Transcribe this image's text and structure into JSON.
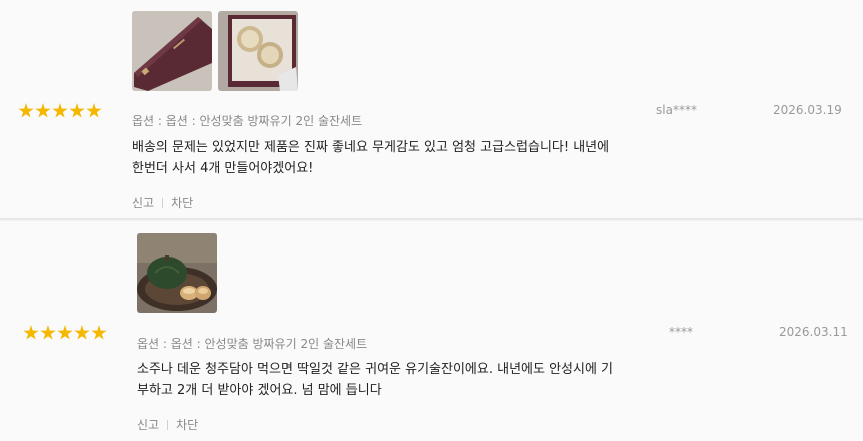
{
  "reviews": [
    {
      "rating": 5,
      "option": "옵션 : 옵션 : 안성맞춤 방짜유기 2인 술잔세트",
      "text": "배송의 문제는 있었지만 제품은 진짜 좋네요 무게감도 있고 엄청 고급스럽습니다! 내년에 한번더 사서 4개 만들어야겠어요!",
      "author": "sla****",
      "date": "2026.03.19",
      "report_label": "신고",
      "block_label": "차단"
    },
    {
      "rating": 5,
      "option": "옵션 : 옵션 : 안성맞춤 방짜유기 2인 술잔세트",
      "text": "소주나 데운 청주담아 먹으면 딱일것 같은 귀여운 유기술잔이에요. 내년에도 안성시에 기부하고 2개 더 받아야 겠어요. 넘 맘에 듭니다",
      "author": "****",
      "date": "2026.03.11",
      "report_label": "신고",
      "block_label": "차단"
    }
  ],
  "colors": {
    "star": "#f5b800",
    "accent_box": "#5a2a34",
    "text": "#222222",
    "muted": "#888888"
  }
}
